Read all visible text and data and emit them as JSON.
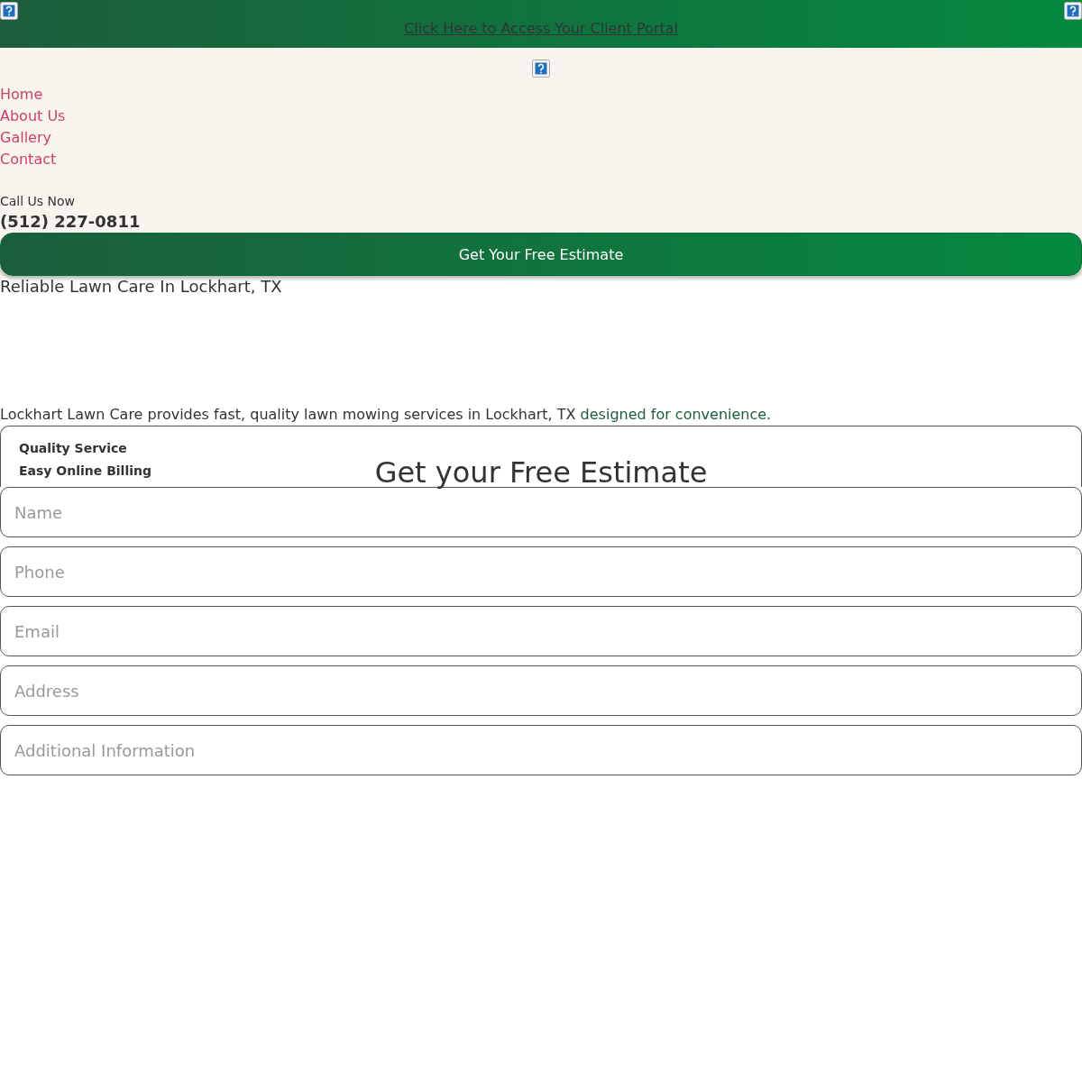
{
  "top_bar": {
    "link": "Click Here to Access Your Client Portal"
  },
  "nav": {
    "items": [
      {
        "label": "Home"
      },
      {
        "label": "About Us"
      },
      {
        "label": "Gallery"
      },
      {
        "label": "Contact"
      }
    ],
    "call_label": "Call Us Now",
    "phone": "(512) 227-0811",
    "cta": "Get Your Free Estimate"
  },
  "hero": {
    "title": "Reliable Lawn Care In Lockhart, TX",
    "intro": "Lockhart Lawn Care provides fast, quality lawn mowing services in Lockhart, TX",
    "intro_highlight": "designed for convenience."
  },
  "features": [
    "Quality Service",
    "Easy Online Billing"
  ],
  "form": {
    "title": "Get your Free Estimate",
    "fields": [
      {
        "placeholder": "Name"
      },
      {
        "placeholder": "Phone"
      },
      {
        "placeholder": "Email"
      },
      {
        "placeholder": "Address"
      },
      {
        "placeholder": "Additional Information"
      }
    ]
  }
}
